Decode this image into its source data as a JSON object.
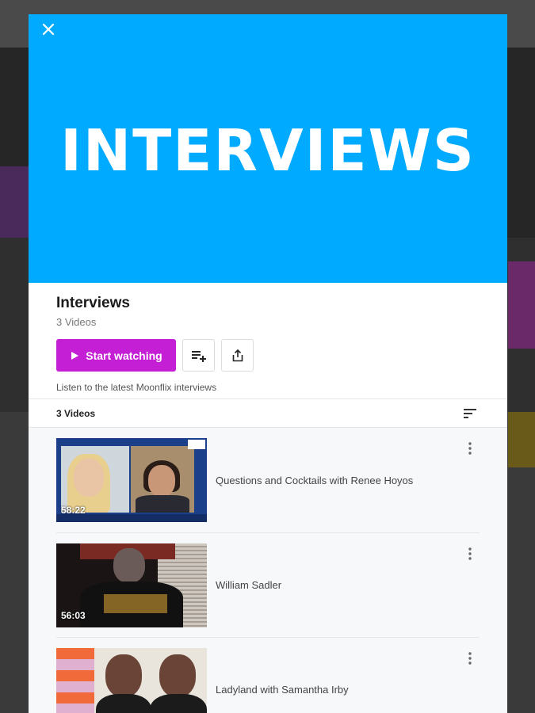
{
  "hero": {
    "title": "INTERVIEWS",
    "background_color": "#00aaff"
  },
  "close_icon": "close-icon",
  "collection": {
    "title": "Interviews",
    "count_label": "3 Videos",
    "description": "Listen to the latest Moonflix interviews"
  },
  "actions": {
    "start_label": "Start watching",
    "start_color": "#c51fd6",
    "add_to_queue_icon": "playlist-add-icon",
    "share_icon": "share-icon"
  },
  "list_header": {
    "label": "3 Videos",
    "sort_icon": "sort-icon"
  },
  "videos": [
    {
      "title": "Questions and Cocktails with Renee Hoyos",
      "duration": "58:22"
    },
    {
      "title": "William Sadler",
      "duration": "56:03"
    },
    {
      "title": "Ladyland with Samantha Irby",
      "duration": ""
    }
  ]
}
